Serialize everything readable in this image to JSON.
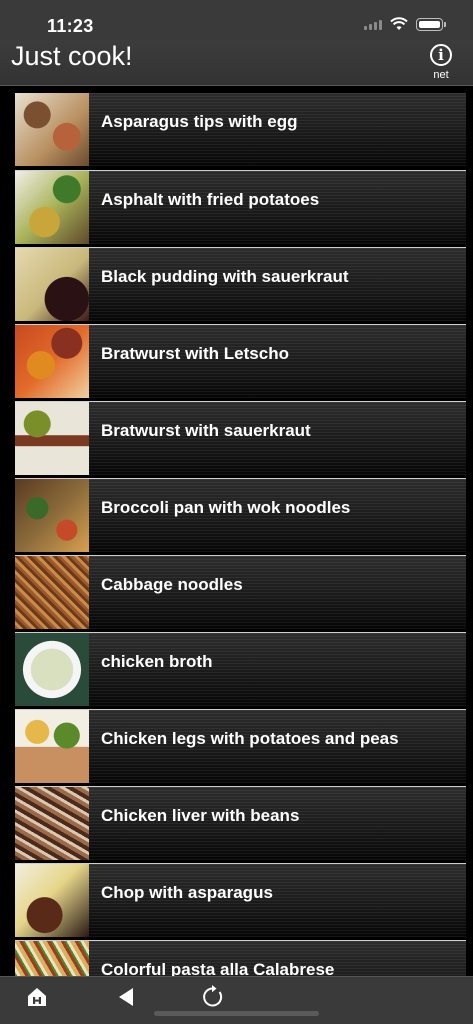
{
  "status_bar": {
    "time": "11:23"
  },
  "header": {
    "title": "Just cook!",
    "info_label": "net"
  },
  "recipes": [
    "Asparagus tips with egg",
    "Asphalt with fried potatoes",
    "Black pudding with sauerkraut",
    "Bratwurst with Letscho",
    "Bratwurst with sauerkraut",
    "Broccoli pan with wok noodles",
    "Cabbage noodles",
    "chicken broth",
    "Chicken legs with potatoes and peas",
    "Chicken liver with beans",
    "Chop with asparagus",
    "Colorful pasta alla Calabrese"
  ],
  "toolbar": {
    "icons": [
      "home-icon",
      "back-icon",
      "reload-icon"
    ]
  },
  "colors": {
    "background": "#000000",
    "bars": "#3a3a3a",
    "text": "#ffffff"
  }
}
